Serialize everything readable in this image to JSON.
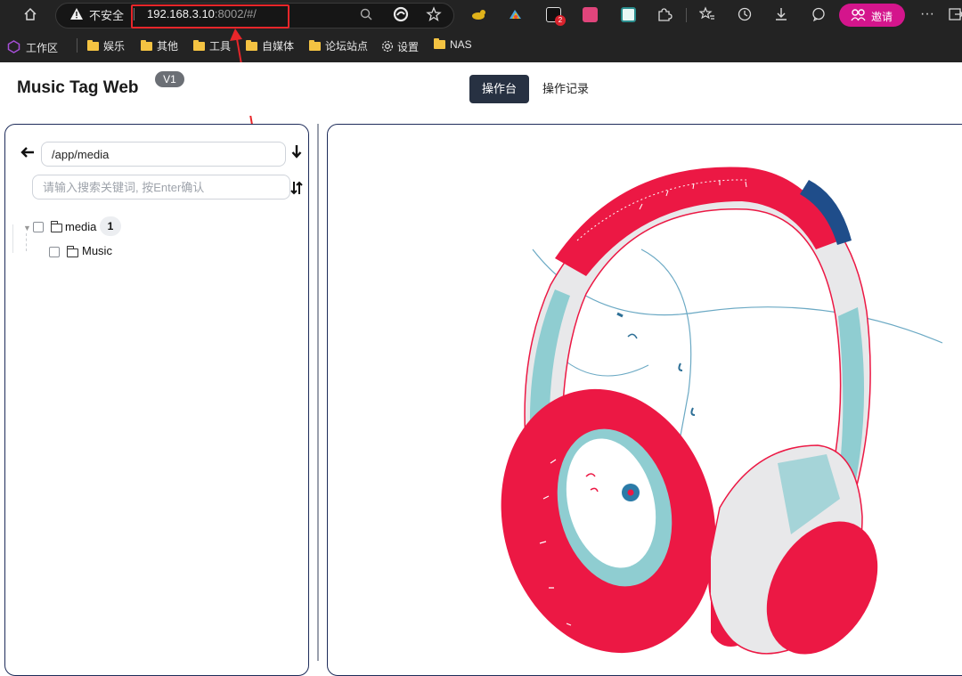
{
  "browser": {
    "insecure_label": "不安全",
    "url_host": "192.168.3.10",
    "url_rest": ":8002/#/",
    "invite_label": "邀请",
    "ext_badge_count": "2",
    "bookmarks": [
      "工作区",
      "娱乐",
      "其他",
      "工具",
      "自媒体",
      "论坛站点",
      "设置",
      "NAS"
    ]
  },
  "app": {
    "title": "Music Tag Web",
    "version": "V1",
    "tabs": [
      "操作台",
      "操作记录"
    ],
    "active_tab": "操作台"
  },
  "file_panel": {
    "path_value": "/app/media",
    "search_placeholder": "请输入搜索关键词, 按Enter确认",
    "tree": {
      "root": {
        "label": "media",
        "count": "1"
      },
      "children": [
        {
          "label": "Music"
        }
      ]
    }
  },
  "colors": {
    "brand_dark": "#273142",
    "panel_border": "#1e2c5a",
    "invite_pink": "#d4158c",
    "annotation_red": "#e8262a",
    "headphone_red": "#ec1844",
    "headphone_teal": "#8fcdd1"
  }
}
